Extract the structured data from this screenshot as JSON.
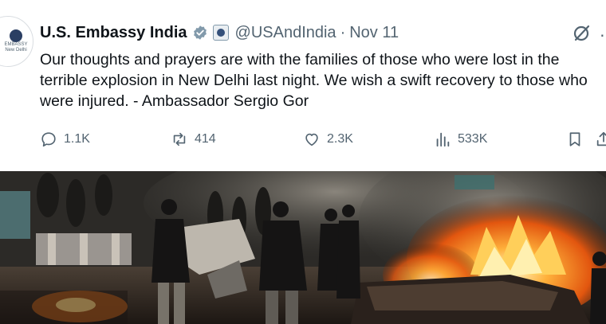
{
  "account": {
    "avatar_text_line1": "EMBASSY",
    "avatar_text_line2": "New Delhi",
    "name": "U.S. Embassy India",
    "handle": "@USAndIndia",
    "separator": "·",
    "date": "Nov 11"
  },
  "tweet": {
    "text": "Our thoughts and prayers are with the families of those who were lost in the terrible explosion in New Delhi last night.  We wish a swift recovery to those who were injured. - Ambassador Sergio Gor"
  },
  "actions": {
    "replies": "1.1K",
    "reposts": "414",
    "likes": "2.3K",
    "views": "533K"
  },
  "colors": {
    "text": "#0f1419",
    "secondary": "#536471",
    "verified_badge": "#829aab",
    "fire": "#ff8a1c"
  },
  "icons": [
    "verified-badge-icon",
    "government-seal-icon",
    "grok-icon",
    "reply-icon",
    "repost-icon",
    "like-icon",
    "views-icon",
    "bookmark-icon",
    "share-icon"
  ]
}
